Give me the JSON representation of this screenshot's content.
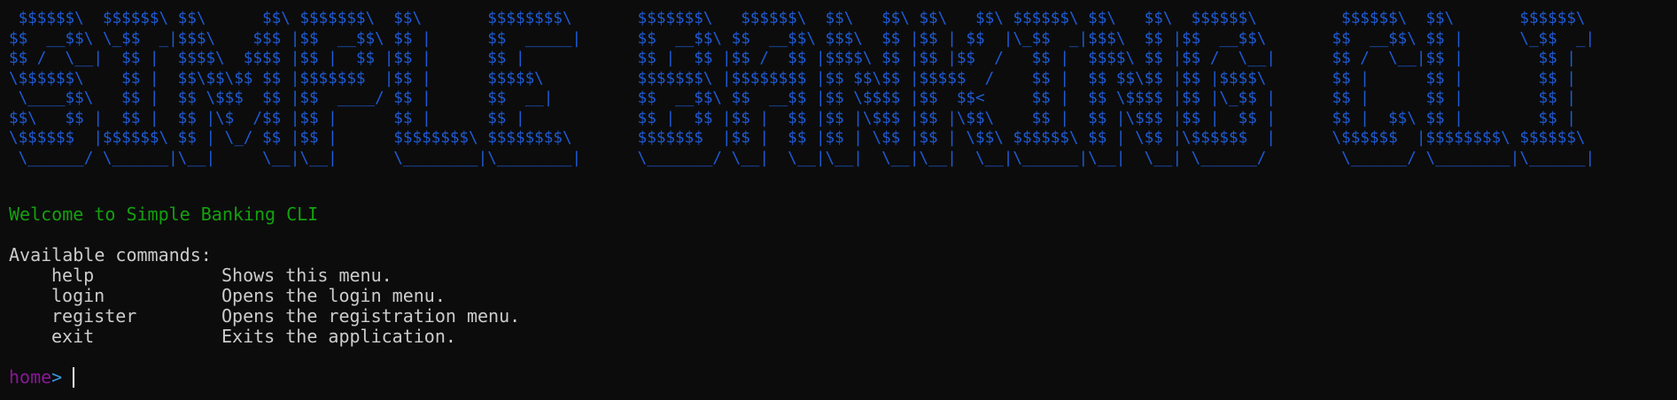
{
  "banner": {
    "lines": [
      " $$$$$$\\  $$$$$$\\ $$\\      $$\\ $$$$$$$\\  $$\\       $$$$$$$$\\       $$$$$$$\\   $$$$$$\\  $$\\   $$\\ $$\\   $$\\ $$$$$$\\ $$\\   $$\\  $$$$$$\\         $$$$$$\\  $$\\       $$$$$$\\ ",
      "$$  __$$\\ \\_$$  _|$$$\\    $$$ |$$  __$$\\ $$ |      $$  _____|      $$  __$$\\ $$  __$$\\ $$$\\  $$ |$$ | $$  |\\_$$  _|$$$\\  $$ |$$  __$$\\       $$  __$$\\ $$ |      \\_$$  _|",
      "$$ /  \\__|  $$ |  $$$$\\  $$$$ |$$ |  $$ |$$ |      $$ |            $$ |  $$ |$$ /  $$ |$$$$\\ $$ |$$ |$$  /   $$ |  $$$$\\ $$ |$$ /  \\__|      $$ /  \\__|$$ |        $$ |  ",
      "\\$$$$$$\\    $$ |  $$\\$$\\$$ $$ |$$$$$$$  |$$ |      $$$$$\\          $$$$$$$\\ |$$$$$$$$ |$$ $$\\$$ |$$$$$  /    $$ |  $$ $$\\$$ |$$ |$$$$\\       $$ |      $$ |        $$ |  ",
      " \\____$$\\   $$ |  $$ \\$$$  $$ |$$  ____/ $$ |      $$  __|         $$  __$$\\ $$  __$$ |$$ \\$$$$ |$$  $$<     $$ |  $$ \\$$$$ |$$ |\\_$$ |      $$ |      $$ |        $$ |  ",
      "$$\\   $$ |  $$ |  $$ |\\$  /$$ |$$ |      $$ |      $$ |            $$ |  $$ |$$ |  $$ |$$ |\\$$$ |$$ |\\$$\\    $$ |  $$ |\\$$$ |$$ |  $$ |      $$ |  $$\\ $$ |        $$ |  ",
      "\\$$$$$$  |$$$$$$\\ $$ | \\_/ $$ |$$ |      $$$$$$$$\\ $$$$$$$$\\       $$$$$$$  |$$ |  $$ |$$ | \\$$ |$$ | \\$$\\ $$$$$$\\ $$ | \\$$ |\\$$$$$$  |      \\$$$$$$  |$$$$$$$$\\ $$$$$$\\ ",
      " \\______/ \\______|\\__|     \\__|\\__|      \\________|\\________|      \\_______/ \\__|  \\__|\\__|  \\__|\\__|  \\__|\\______|\\__|  \\__| \\______/        \\______/ \\________|\\______|"
    ],
    "color": "#1e5bd6"
  },
  "welcome": {
    "text": "Welcome to Simple Banking CLI",
    "color": "#13a10e"
  },
  "commands": {
    "heading": "Available commands:",
    "items": [
      {
        "name": "help",
        "description": "Shows this menu."
      },
      {
        "name": "login",
        "description": "Opens the login menu."
      },
      {
        "name": "register",
        "description": "Opens the registration menu."
      },
      {
        "name": "exit",
        "description": "Exits the application."
      }
    ]
  },
  "prompt": {
    "name": "home",
    "symbol": ">",
    "input_value": "",
    "name_color": "#881798",
    "symbol_color": "#3a96dd"
  },
  "theme": {
    "background": "#0c0c0c",
    "foreground": "#cccccc"
  }
}
